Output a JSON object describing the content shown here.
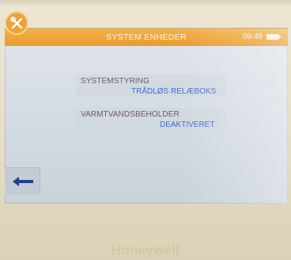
{
  "header": {
    "title": "SYSTEM ENHEDER",
    "time": "09:48",
    "battery_icon": "battery-icon",
    "settings_icon": "wrench-screwdriver-icon",
    "accent_color": "#ee9f30"
  },
  "rows": [
    {
      "label": "SYSTEMSTYRING",
      "value": "TRÅDLØS RELÆBOKS"
    },
    {
      "label": "VARMTVANDSBEHOLDER",
      "value": "DEAKTIVERET"
    }
  ],
  "footer": {
    "back_icon": "arrow-left-icon",
    "brand": "Honeywell"
  }
}
